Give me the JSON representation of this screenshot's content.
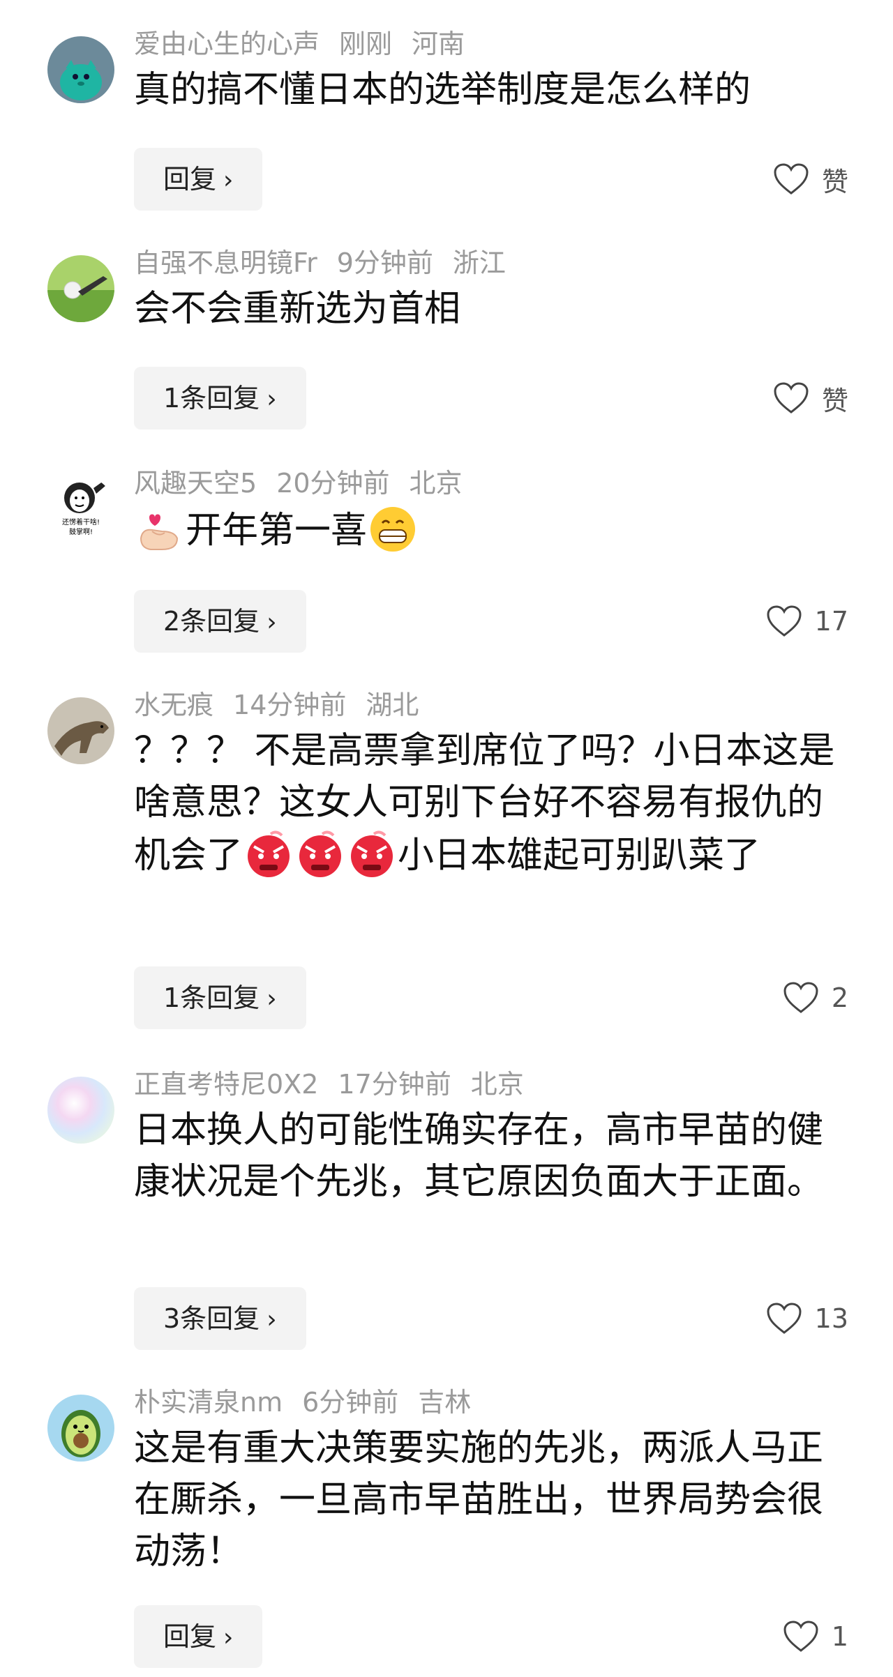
{
  "comments": [
    {
      "username": "爱由心生的心声",
      "time": "刚刚",
      "location": "河南",
      "text": "真的搞不懂日本的选举制度是怎么样的",
      "reply_label": "回复",
      "like_label": "赞",
      "avatar_icon": "green-monster-avatar"
    },
    {
      "username": "自强不息明镜Fr",
      "time": "9分钟前",
      "location": "浙江",
      "text": "会不会重新选为首相",
      "reply_label": "1条回复",
      "like_label": "赞",
      "avatar_icon": "golf-ball-avatar"
    },
    {
      "username": "风趣天空5",
      "time": "20分钟前",
      "location": "北京",
      "text": "开年第一喜",
      "reply_label": "2条回复",
      "like_label": "17",
      "avatar_icon": "meme-face-avatar",
      "avatar_text_1": "还愣着干啥!",
      "avatar_text_2": "鼓掌啊!"
    },
    {
      "username": "水无痕",
      "time": "14分钟前",
      "location": "湖北",
      "text_1": "？？？ 不是高票拿到席位了吗？小日本这是啥意思？这女人可别下台好不容易有报仇的机会了",
      "text_2": "小日本雄起可别趴菜了",
      "reply_label": "1条回复",
      "like_label": "2",
      "avatar_icon": "dinosaur-avatar"
    },
    {
      "username": "正直考特尼0X2",
      "time": "17分钟前",
      "location": "北京",
      "text": "日本换人的可能性确实存在，高市早苗的健康状况是个先兆，其它原因负面大于正面。",
      "reply_label": "3条回复",
      "like_label": "13",
      "avatar_icon": "pastel-gradient-avatar"
    },
    {
      "username": "朴实清泉nm",
      "time": "6分钟前",
      "location": "吉林",
      "text": "这是有重大决策要实施的先兆，两派人马正在厮杀，一旦高市早苗胜出，世界局势会很动荡！",
      "reply_label": "回复",
      "like_label": "1",
      "avatar_icon": "avocado-avatar"
    }
  ],
  "chevron": "›",
  "colors": {
    "meta": "#9a9a9a",
    "text": "#111111",
    "button_bg": "#f3f3f3"
  }
}
